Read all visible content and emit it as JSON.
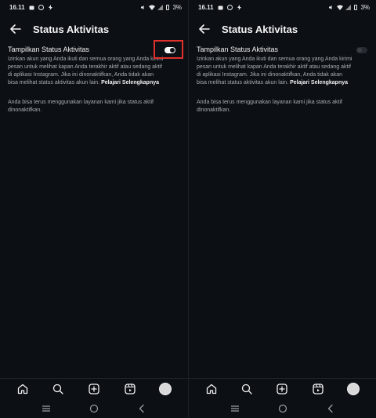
{
  "screens": [
    {
      "status_bar": {
        "time": "16.11",
        "battery": "3%"
      },
      "header": {
        "title": "Status Aktivitas"
      },
      "setting": {
        "title": "Tampilkan Status Aktivitas",
        "description": "Izinkan akun yang Anda ikuti dan semua orang yang Anda kirimi pesan untuk melihat kapan Anda terakhir aktif atau sedang aktif di aplikasi Instagram. Jika ini dinonaktifkan, Anda tidak akan bisa melihat status aktivitas akun lain.",
        "learn_more": "Pelajari Selengkapnya",
        "toggle_state": "on"
      },
      "note": "Anda bisa terus menggunakan layanan kami jika status aktif dinonaktifkan.",
      "highlight_color": "#e0302b"
    },
    {
      "status_bar": {
        "time": "16.11",
        "battery": "3%"
      },
      "header": {
        "title": "Status Aktivitas"
      },
      "setting": {
        "title": "Tampilkan Status Aktivitas",
        "description": "Izinkan akun yang Anda ikuti dan semua orang yang Anda kirimi pesan untuk melihat kapan Anda terakhir aktif atau sedang aktif di aplikasi Instagram. Jika ini dinonaktifkan, Anda tidak akan bisa melihat status aktivitas akun lain.",
        "learn_more": "Pelajari Selengkapnya",
        "toggle_state": "off"
      },
      "note": "Anda bisa terus menggunakan layanan kami jika status aktif dinonaktifkan."
    }
  ],
  "bottom_nav": [
    "home-icon",
    "search-icon",
    "create-icon",
    "reels-icon",
    "profile-avatar"
  ],
  "system_nav": [
    "recents-icon",
    "home-circle-icon",
    "back-chevron-icon"
  ],
  "colors": {
    "background": "#0c1015",
    "text": "#f2f2f2",
    "muted": "#a8adb3"
  }
}
